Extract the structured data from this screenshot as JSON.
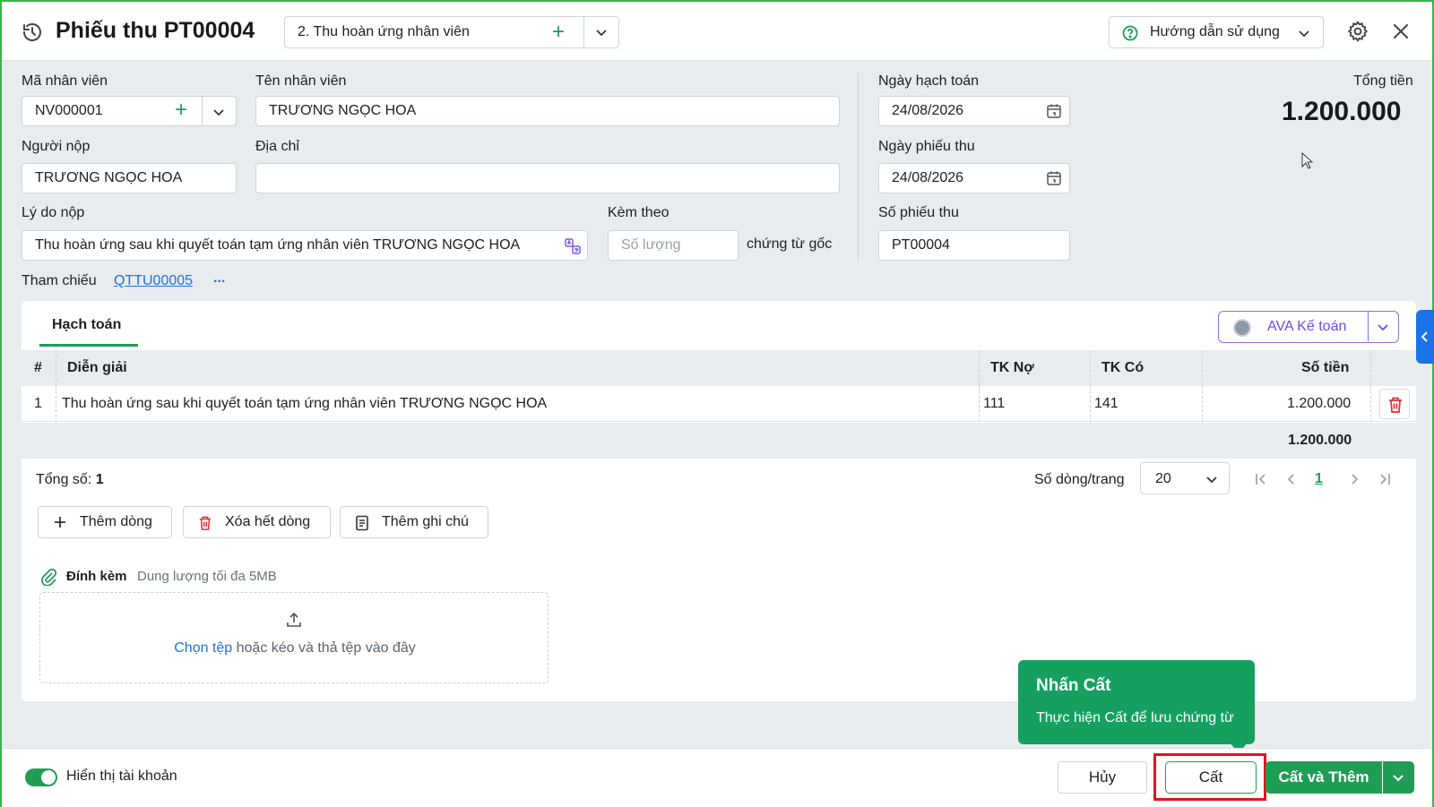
{
  "header": {
    "title": "Phiếu thu PT00004",
    "type_value": "2. Thu hoàn ứng nhân viên",
    "help_label": "Hướng dẫn sử dụng"
  },
  "form": {
    "employee_code_label": "Mã nhân viên",
    "employee_code_value": "NV000001",
    "employee_name_label": "Tên nhân viên",
    "employee_name_value": "TRƯƠNG NGỌC HOA",
    "payer_label": "Người nộp",
    "payer_value": "TRƯƠNG NGỌC HOA",
    "address_label": "Địa chỉ",
    "address_value": "",
    "reason_label": "Lý do nộp",
    "reason_value": "Thu hoàn ứng sau khi quyết toán tạm ứng nhân viên TRƯƠNG NGỌC HOA",
    "attached_label": "Kèm theo",
    "attached_placeholder": "Số lượng",
    "attached_suffix": "chứng từ gốc",
    "posting_date_label": "Ngày hạch toán",
    "posting_date_value": "24/08/2026",
    "receipt_date_label": "Ngày phiếu thu",
    "receipt_date_value": "24/08/2026",
    "receipt_no_label": "Số phiếu thu",
    "receipt_no_value": "PT00004",
    "total_label": "Tổng tiền",
    "total_value": "1.200.000",
    "reference_label": "Tham chiếu",
    "reference_link": "QTTU00005",
    "reference_more": "..."
  },
  "panel": {
    "tab_label": "Hạch toán",
    "ava_label": "AVA Kế toán",
    "columns": [
      "#",
      "Diễn giải",
      "TK Nợ",
      "TK Có",
      "Số tiền"
    ],
    "rows": [
      {
        "no": "1",
        "desc": "Thu hoàn ứng sau khi quyết toán tạm ứng nhân viên TRƯƠNG NGỌC HOA",
        "debit": "111",
        "credit": "141",
        "amount": "1.200.000"
      }
    ],
    "sum_amount": "1.200.000",
    "count_label": "Tổng số:",
    "count_value": "1",
    "rows_per_page_label": "Số dòng/trang",
    "rows_per_page_value": "20",
    "current_page": "1",
    "add_row_label": "Thêm dòng",
    "clear_rows_label": "Xóa hết dòng",
    "add_note_label": "Thêm ghi chú",
    "attach_label": "Đính kèm",
    "attach_hint": "Dung lượng tối đa 5MB",
    "dropzone_link": "Chọn tệp",
    "dropzone_text": "hoặc kéo và thả tệp vào đây"
  },
  "footer": {
    "toggle_label": "Hiển thị tài khoản",
    "cancel_label": "Hủy",
    "save_label": "Cất",
    "save_add_label": "Cất và Thêm"
  },
  "tooltip": {
    "title": "Nhấn Cất",
    "text": "Thực hiện Cất để lưu chứng từ"
  },
  "colors": {
    "accent_green": "#1f9d55",
    "link_blue": "#1a73e8",
    "highlight_red": "#e0141e",
    "ava_purple": "#6b4ce0"
  }
}
